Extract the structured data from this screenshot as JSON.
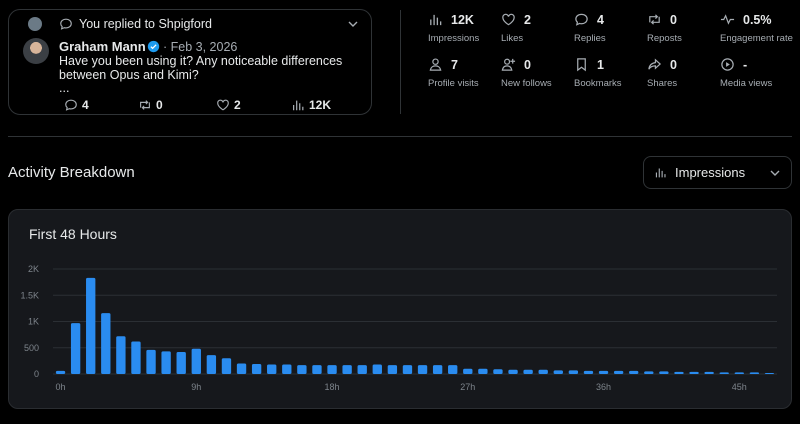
{
  "reply": {
    "context_text": "You replied to Shpigford",
    "author_name": "Graham Mann",
    "date": "· Feb 3, 2026",
    "body_line1": "Have you been using it? Any noticeable differences",
    "body_line2": "between Opus and Kimi?",
    "body_line3": "...",
    "replies": "4",
    "reposts": "0",
    "likes": "2",
    "views": "12K"
  },
  "stats": [
    {
      "icon": "bar-chart-icon",
      "value": "12K",
      "label": "Impressions"
    },
    {
      "icon": "heart-icon",
      "value": "2",
      "label": "Likes"
    },
    {
      "icon": "reply-icon",
      "value": "4",
      "label": "Replies"
    },
    {
      "icon": "repost-icon",
      "value": "0",
      "label": "Reposts"
    },
    {
      "icon": "pulse-icon",
      "value": "0.5%",
      "label": "Engagement rate"
    },
    {
      "icon": "person-icon",
      "value": "7",
      "label": "Profile visits"
    },
    {
      "icon": "add-person-icon",
      "value": "0",
      "label": "New follows"
    },
    {
      "icon": "bookmark-icon",
      "value": "1",
      "label": "Bookmarks"
    },
    {
      "icon": "share-icon",
      "value": "0",
      "label": "Shares"
    },
    {
      "icon": "play-icon",
      "value": "-",
      "label": "Media views"
    }
  ],
  "section_title": "Activity Breakdown",
  "dropdown": {
    "selected": "Impressions"
  },
  "colors": {
    "bar": "#2a8cf0",
    "background": "#000000",
    "card": "#16181c",
    "border": "#2f3336"
  },
  "chart_data": {
    "type": "bar",
    "title": "First 48 Hours",
    "ylim": [
      0,
      2000
    ],
    "y_ticks": [
      "0",
      "500",
      "1K",
      "1.5K",
      "2K"
    ],
    "x_tick_labels": [
      "0h",
      "9h",
      "18h",
      "27h",
      "36h",
      "45h"
    ],
    "x_ticks_at": [
      0,
      9,
      18,
      27,
      36,
      45
    ],
    "x": [
      0,
      1,
      2,
      3,
      4,
      5,
      6,
      7,
      8,
      9,
      10,
      11,
      12,
      13,
      14,
      15,
      16,
      17,
      18,
      19,
      20,
      21,
      22,
      23,
      24,
      25,
      26,
      27,
      28,
      29,
      30,
      31,
      32,
      33,
      34,
      35,
      36,
      37,
      38,
      39,
      40,
      41,
      42,
      43,
      44,
      45,
      46,
      47
    ],
    "values": [
      60,
      970,
      1830,
      1160,
      720,
      620,
      460,
      430,
      420,
      480,
      360,
      300,
      200,
      190,
      180,
      180,
      170,
      170,
      170,
      170,
      170,
      180,
      170,
      170,
      170,
      170,
      170,
      100,
      100,
      90,
      80,
      80,
      80,
      70,
      70,
      60,
      60,
      60,
      60,
      50,
      50,
      40,
      40,
      40,
      30,
      30,
      30,
      20
    ],
    "grid": true,
    "legend": "none"
  }
}
